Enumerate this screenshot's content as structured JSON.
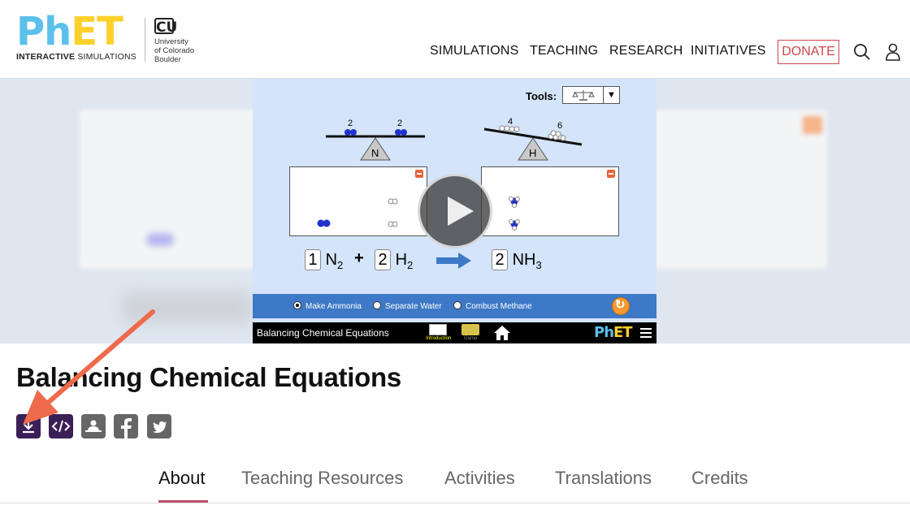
{
  "header": {
    "logo": {
      "word_a": "Ph",
      "word_b": "ET",
      "sub_a": "INTERACTIVE",
      "sub_b": " SIMULATIONS"
    },
    "cu": {
      "mark": "CU",
      "line1": "University",
      "line2": "of Colorado",
      "line3": "Boulder"
    },
    "nav": [
      "SIMULATIONS",
      "TEACHING",
      "RESEARCH",
      "INITIATIVES"
    ],
    "donate_label": "DONATE",
    "search_icon": "search-icon",
    "account_icon": "user-icon"
  },
  "sim": {
    "tools_label": "Tools:",
    "balance_left": {
      "left_count": "2",
      "right_count": "2",
      "element": "N"
    },
    "balance_right": {
      "left_count": "4",
      "right_count": "6",
      "element": "H"
    },
    "equation": {
      "c1": "1",
      "m1": "N",
      "s1": "2",
      "plus": "+",
      "c2": "2",
      "m2": "H",
      "s2": "2",
      "c3": "2",
      "m3": "NH",
      "s3": "3"
    },
    "radios": [
      "Make Ammonia",
      "Separate Water",
      "Combust Methane"
    ],
    "selected_radio": "Make Ammonia",
    "title": "Balancing Chemical Equations",
    "screens": [
      "Introduction",
      "Game"
    ],
    "logo_a": "Ph",
    "logo_b": "ET",
    "colors": {
      "panel": "#d4e4fa",
      "controls": "#3d79c6",
      "nitrogen": "#2233cc",
      "arrow": "#3d79c6"
    }
  },
  "page": {
    "title": "Balancing Chemical Equations",
    "share_icons": [
      "download-icon",
      "embed-code-icon",
      "classroom-icon",
      "facebook-icon",
      "twitter-icon"
    ],
    "tabs": [
      "About",
      "Teaching Resources",
      "Activities",
      "Translations",
      "Credits"
    ],
    "active_tab": "About",
    "colors": {
      "share_active": "#3b1f57",
      "share_inactive": "#666666",
      "tab_underline": "#c0506c",
      "annotation_arrow": "#ef6a4c"
    }
  }
}
